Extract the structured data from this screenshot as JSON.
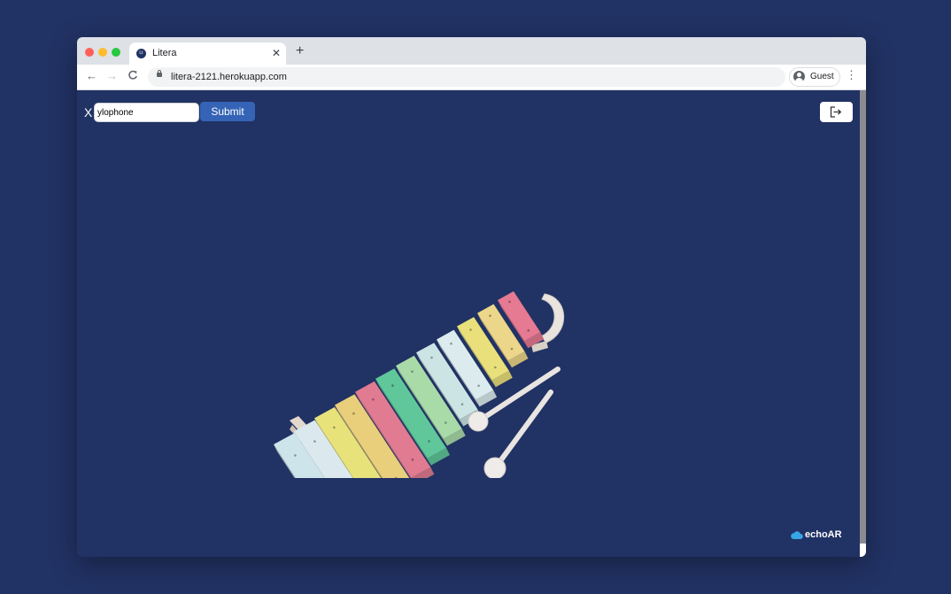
{
  "browser": {
    "tab": {
      "title": "Litera",
      "favicon_text": "Lt",
      "close_icon": "close-icon"
    },
    "new_tab_symbol": "+",
    "url": "litera-2121.herokuapp.com",
    "profile": {
      "label": "Guest"
    },
    "nav": {
      "back": "←",
      "forward": "→",
      "reload": "C",
      "menu": "⋮"
    }
  },
  "page": {
    "prefix_label": "X",
    "search": {
      "value": "ylophone"
    },
    "submit_label": "Submit",
    "logout_icon": "logout-icon",
    "model_subject": "xylophone-3d-model",
    "watermark": "echoAR"
  },
  "colors": {
    "background": "#213264",
    "submit_button": "#3564b6",
    "xylophone_bars": [
      "#cde4ea",
      "#dbe9ee",
      "#e8e27a",
      "#e9cf7c",
      "#e07b92",
      "#5fc79a",
      "#a9dba8",
      "#cce5e4",
      "#dcebed",
      "#e9e07b",
      "#ecd68a",
      "#e57a92"
    ]
  }
}
